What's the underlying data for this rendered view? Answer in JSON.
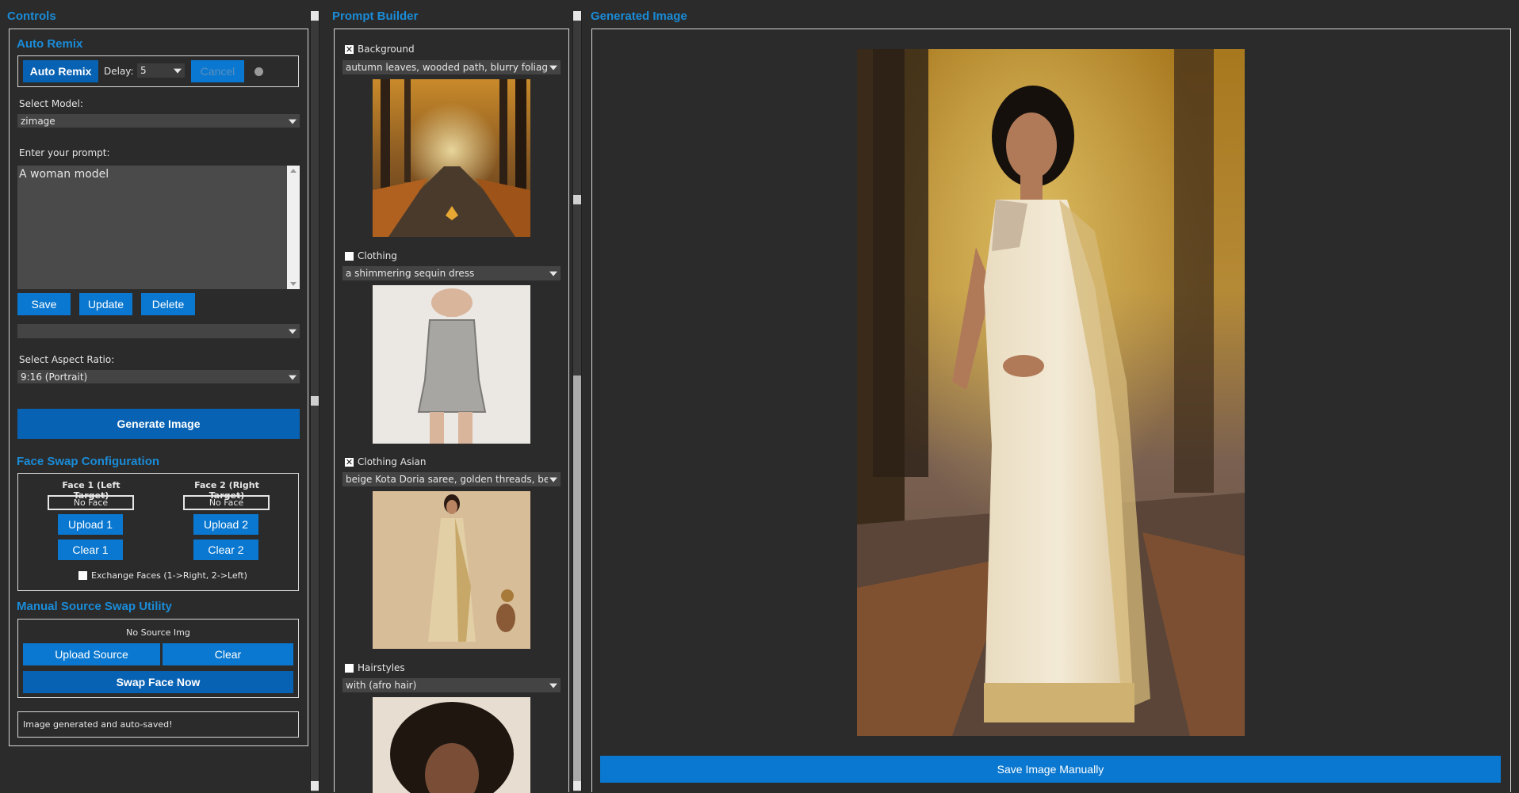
{
  "controls": {
    "title": "Controls",
    "auto_remix": {
      "title": "Auto Remix",
      "button": "Auto Remix",
      "delay_label": "Delay:",
      "delay_value": "5",
      "cancel": "Cancel"
    },
    "select_model_label": "Select Model:",
    "model_value": "zimage",
    "prompt_label": "Enter your prompt:",
    "prompt_value": "A woman model",
    "save": "Save",
    "update": "Update",
    "delete": "Delete",
    "preset_value": "",
    "aspect_label": "Select Aspect Ratio:",
    "aspect_value": "9:16 (Portrait)",
    "generate": "Generate Image"
  },
  "face_swap": {
    "title": "Face Swap Configuration",
    "face1_label": "Face 1 (Left Target)",
    "face2_label": "Face 2 (Right Target)",
    "face1_status": "No Face",
    "face2_status": "No Face",
    "upload1": "Upload 1",
    "upload2": "Upload 2",
    "clear1": "Clear 1",
    "clear2": "Clear 2",
    "exchange_label": "Exchange Faces (1->Right, 2->Left)"
  },
  "manual_swap": {
    "title": "Manual Source Swap Utility",
    "status": "No Source Img",
    "upload_source": "Upload Source",
    "clear": "Clear",
    "swap_now": "Swap Face Now"
  },
  "status_message": "Image generated and auto-saved!",
  "prompt_builder": {
    "title": "Prompt Builder",
    "sections": [
      {
        "label": "Background",
        "checked": true,
        "value": "autumn leaves, wooded path, blurry foliage, natu"
      },
      {
        "label": "Clothing",
        "checked": false,
        "value": "a shimmering sequin dress"
      },
      {
        "label": "Clothing Asian",
        "checked": true,
        "value": "beige Kota Doria saree, golden threads, beige blo"
      },
      {
        "label": "Hairstyles",
        "checked": false,
        "value": "with (afro hair)"
      }
    ]
  },
  "generated": {
    "title": "Generated Image",
    "save_manual": "Save Image Manually"
  },
  "colors": {
    "accent": "#1a8cd8",
    "button": "#0a78d0",
    "button_dark": "#0862b3",
    "background": "#2b2b2b"
  }
}
